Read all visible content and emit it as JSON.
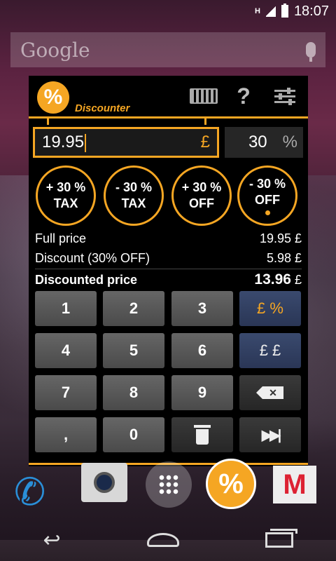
{
  "status": {
    "time": "18:07",
    "signal": "H"
  },
  "search": {
    "logo_text": "Google"
  },
  "app": {
    "name": "Discounter",
    "logo_glyph": "%",
    "help_glyph": "?",
    "price_value": "19.95",
    "currency_symbol": "£",
    "percent_value": "30",
    "percent_symbol": "%",
    "modes": [
      {
        "line1": "+ 30 %",
        "line2": "TAX"
      },
      {
        "line1": "- 30 %",
        "line2": "TAX"
      },
      {
        "line1": "+ 30 %",
        "line2": "OFF"
      },
      {
        "line1": "- 30 %",
        "line2": "OFF"
      }
    ],
    "results": {
      "full_price_label": "Full price",
      "full_price_value": "19.95 £",
      "discount_label": "Discount (30% OFF)",
      "discount_value": "5.98 £",
      "discounted_label": "Discounted price",
      "discounted_value": "13.96",
      "discounted_currency": "£"
    },
    "keys": [
      "1",
      "2",
      "3",
      "£ %",
      "4",
      "5",
      "6",
      "£ £",
      "7",
      "8",
      "9",
      ",",
      "0"
    ],
    "backspace_glyph": "✕",
    "skip_glyph": "▶▶|"
  },
  "dock": {
    "discounter_glyph": "%",
    "gmail_glyph": "M",
    "phone_glyph": "✆"
  },
  "nav": {
    "back_glyph": "↩"
  },
  "colors": {
    "accent": "#f5a623",
    "blue_key": "#3a4a6e"
  }
}
